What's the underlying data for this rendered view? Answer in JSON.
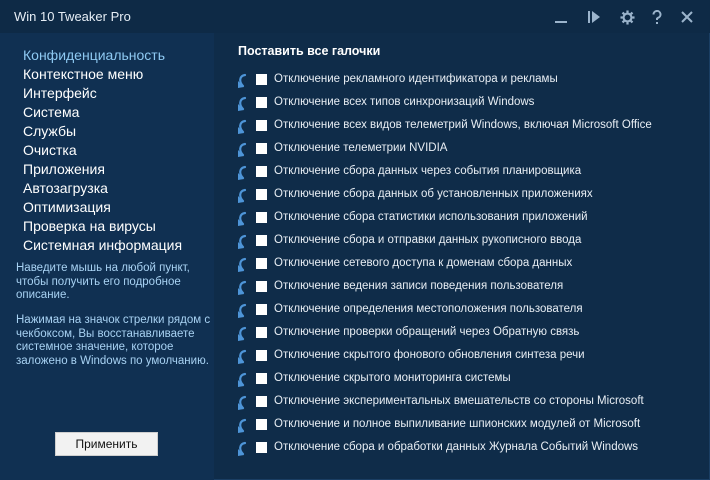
{
  "window": {
    "title": "Win 10 Tweaker Pro",
    "accent_color": "#8ec9f2",
    "background_color": "#0f2c49"
  },
  "titlebar_buttons": [
    {
      "name": "minimize-icon",
      "glyph": "—"
    },
    {
      "name": "play-icon",
      "glyph": "▶"
    },
    {
      "name": "gear-icon",
      "glyph": "⚙"
    },
    {
      "name": "help-icon",
      "glyph": "?"
    },
    {
      "name": "close-icon",
      "glyph": "✕"
    }
  ],
  "sidebar": {
    "items": [
      {
        "label": "Конфиденциальность",
        "active": true
      },
      {
        "label": "Контекстное меню",
        "active": false
      },
      {
        "label": "Интерфейс",
        "active": false
      },
      {
        "label": "Система",
        "active": false
      },
      {
        "label": "Службы",
        "active": false
      },
      {
        "label": "Очистка",
        "active": false
      },
      {
        "label": "Приложения",
        "active": false
      },
      {
        "label": "Автозагрузка",
        "active": false
      },
      {
        "label": "Оптимизация",
        "active": false
      },
      {
        "label": "Проверка на вирусы",
        "active": false
      },
      {
        "label": "Системная информация",
        "active": false
      }
    ],
    "hint1": "Наведите мышь на любой пункт, чтобы получить его подробное описание.",
    "hint2": "Нажимая на значок стрелки рядом с чекбоксом, Вы восстанавливаете системное значение, которое заложено в Windows по умолчанию.",
    "apply_label": "Применить"
  },
  "main": {
    "check_all_label": "Поставить все галочки",
    "options": [
      {
        "label": "Отключение рекламного идентификатора и рекламы",
        "checked": false
      },
      {
        "label": "Отключение всех типов синхронизаций Windows",
        "checked": false
      },
      {
        "label": "Отключение всех видов телеметрий Windows, включая Microsoft Office",
        "checked": false
      },
      {
        "label": "Отключение телеметрии NVIDIA",
        "checked": false
      },
      {
        "label": "Отключение сбора данных через события планировщика",
        "checked": false
      },
      {
        "label": "Отключение сбора данных об установленных приложениях",
        "checked": false
      },
      {
        "label": "Отключение сбора статистики использования приложений",
        "checked": false
      },
      {
        "label": "Отключение сбора и отправки данных рукописного ввода",
        "checked": false
      },
      {
        "label": "Отключение сетевого доступа к доменам сбора данных",
        "checked": false
      },
      {
        "label": "Отключение ведения записи поведения пользователя",
        "checked": false
      },
      {
        "label": "Отключение определения местоположения пользователя",
        "checked": false
      },
      {
        "label": "Отключение проверки обращений через Обратную связь",
        "checked": false
      },
      {
        "label": "Отключение скрытого фонового обновления синтеза речи",
        "checked": false
      },
      {
        "label": "Отключение скрытого мониторинга системы",
        "checked": false
      },
      {
        "label": "Отключение экспериментальных вмешательств со стороны Microsoft",
        "checked": false
      },
      {
        "label": "Отключение и полное выпиливание шпионских модулей от Microsoft",
        "checked": false
      },
      {
        "label": "Отключение сбора и обработки данных Журнала Событий Windows",
        "checked": false
      }
    ]
  }
}
